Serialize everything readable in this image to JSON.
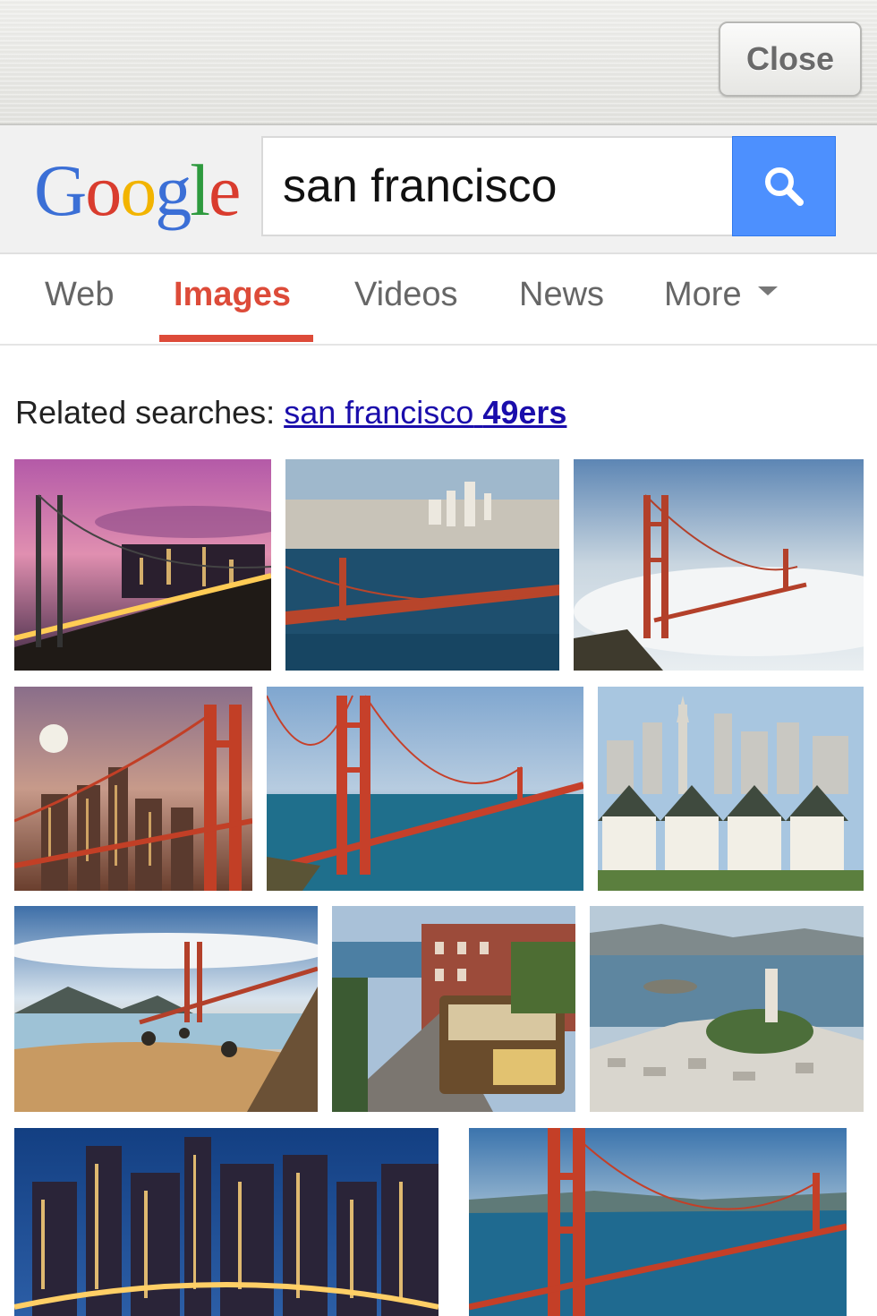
{
  "topbar": {
    "close_label": "Close"
  },
  "search": {
    "logo_letters": [
      "G",
      "o",
      "o",
      "g",
      "l",
      "e"
    ],
    "logo_colors": [
      "#3b6fd6",
      "#d93c2e",
      "#f2b400",
      "#3b6fd6",
      "#2e9a3e",
      "#d93c2e"
    ],
    "query": "san francisco",
    "button_icon": "search-icon",
    "button_color": "#4d90fe"
  },
  "tabs": [
    {
      "label": "Web",
      "active": false
    },
    {
      "label": "Images",
      "active": true
    },
    {
      "label": "Videos",
      "active": false
    },
    {
      "label": "News",
      "active": false
    },
    {
      "label": "More",
      "active": false
    }
  ],
  "active_tab_color": "#dd4b39",
  "related": {
    "prefix": "Related searches:",
    "link_normal": "san francisco",
    "link_bold": "49ers"
  },
  "images": [
    {
      "subject": "Bay Bridge at dusk with city skyline"
    },
    {
      "subject": "Aerial view of city and Golden Gate Bridge"
    },
    {
      "subject": "Golden Gate Bridge over fog"
    },
    {
      "subject": "Golden Gate Bridge with moon and city lights"
    },
    {
      "subject": "Golden Gate Bridge over the bay"
    },
    {
      "subject": "Painted Ladies houses and skyline"
    },
    {
      "subject": "Golden Gate Bridge from the beach"
    },
    {
      "subject": "Cable car on a city street"
    },
    {
      "subject": "Coit Tower with Alcatraz in the bay"
    },
    {
      "subject": "City skyline at night"
    },
    {
      "subject": "Golden Gate Bridge tower close-up"
    }
  ]
}
